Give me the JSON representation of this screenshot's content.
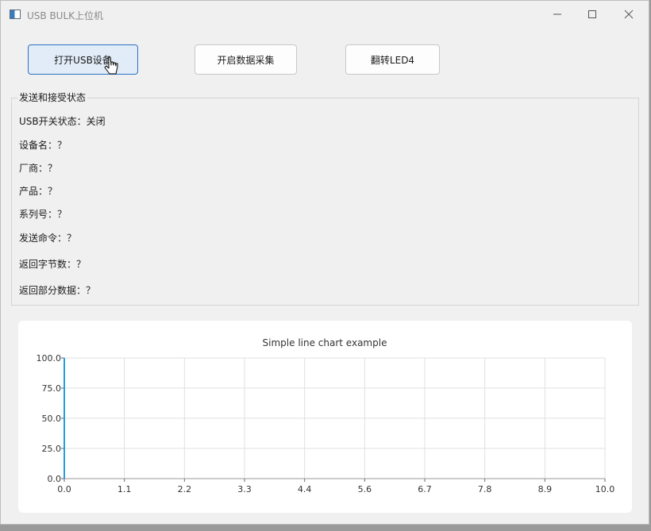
{
  "window": {
    "title": "USB BULK上位机",
    "controls": {
      "minimize": "minimize-icon",
      "maximize": "maximize-icon",
      "close": "close-icon"
    }
  },
  "toolbar": {
    "open_usb_label": "打开USB设备",
    "start_capture_label": "开启数据采集",
    "toggle_led_label": "翻转LED4"
  },
  "status_group": {
    "title": "发送和接受状态",
    "usb_state": "USB开关状态：关闭",
    "device_name": "设备名：？",
    "vendor": "厂商：？",
    "product": "产品：？",
    "serial": "系列号：？",
    "send_command": "发送命令：？",
    "return_bytes": "返回字节数：？",
    "return_data": "返回部分数据：？"
  },
  "colors": {
    "accent": "#2b72c2",
    "series_line": "#209fdf",
    "grid": "#e0e0e0"
  },
  "chart_data": {
    "type": "line",
    "title": "Simple line chart example",
    "xlim": [
      0,
      10
    ],
    "ylim": [
      0,
      100
    ],
    "x_ticks": [
      "0.0",
      "1.1",
      "2.2",
      "3.3",
      "4.4",
      "5.6",
      "6.7",
      "7.8",
      "8.9",
      "10.0"
    ],
    "y_ticks": [
      "0.0",
      "25.0",
      "50.0",
      "75.0",
      "100.0"
    ],
    "grid": true,
    "series": [
      {
        "x": [
          0,
          0
        ],
        "y": [
          0,
          100
        ]
      }
    ]
  }
}
